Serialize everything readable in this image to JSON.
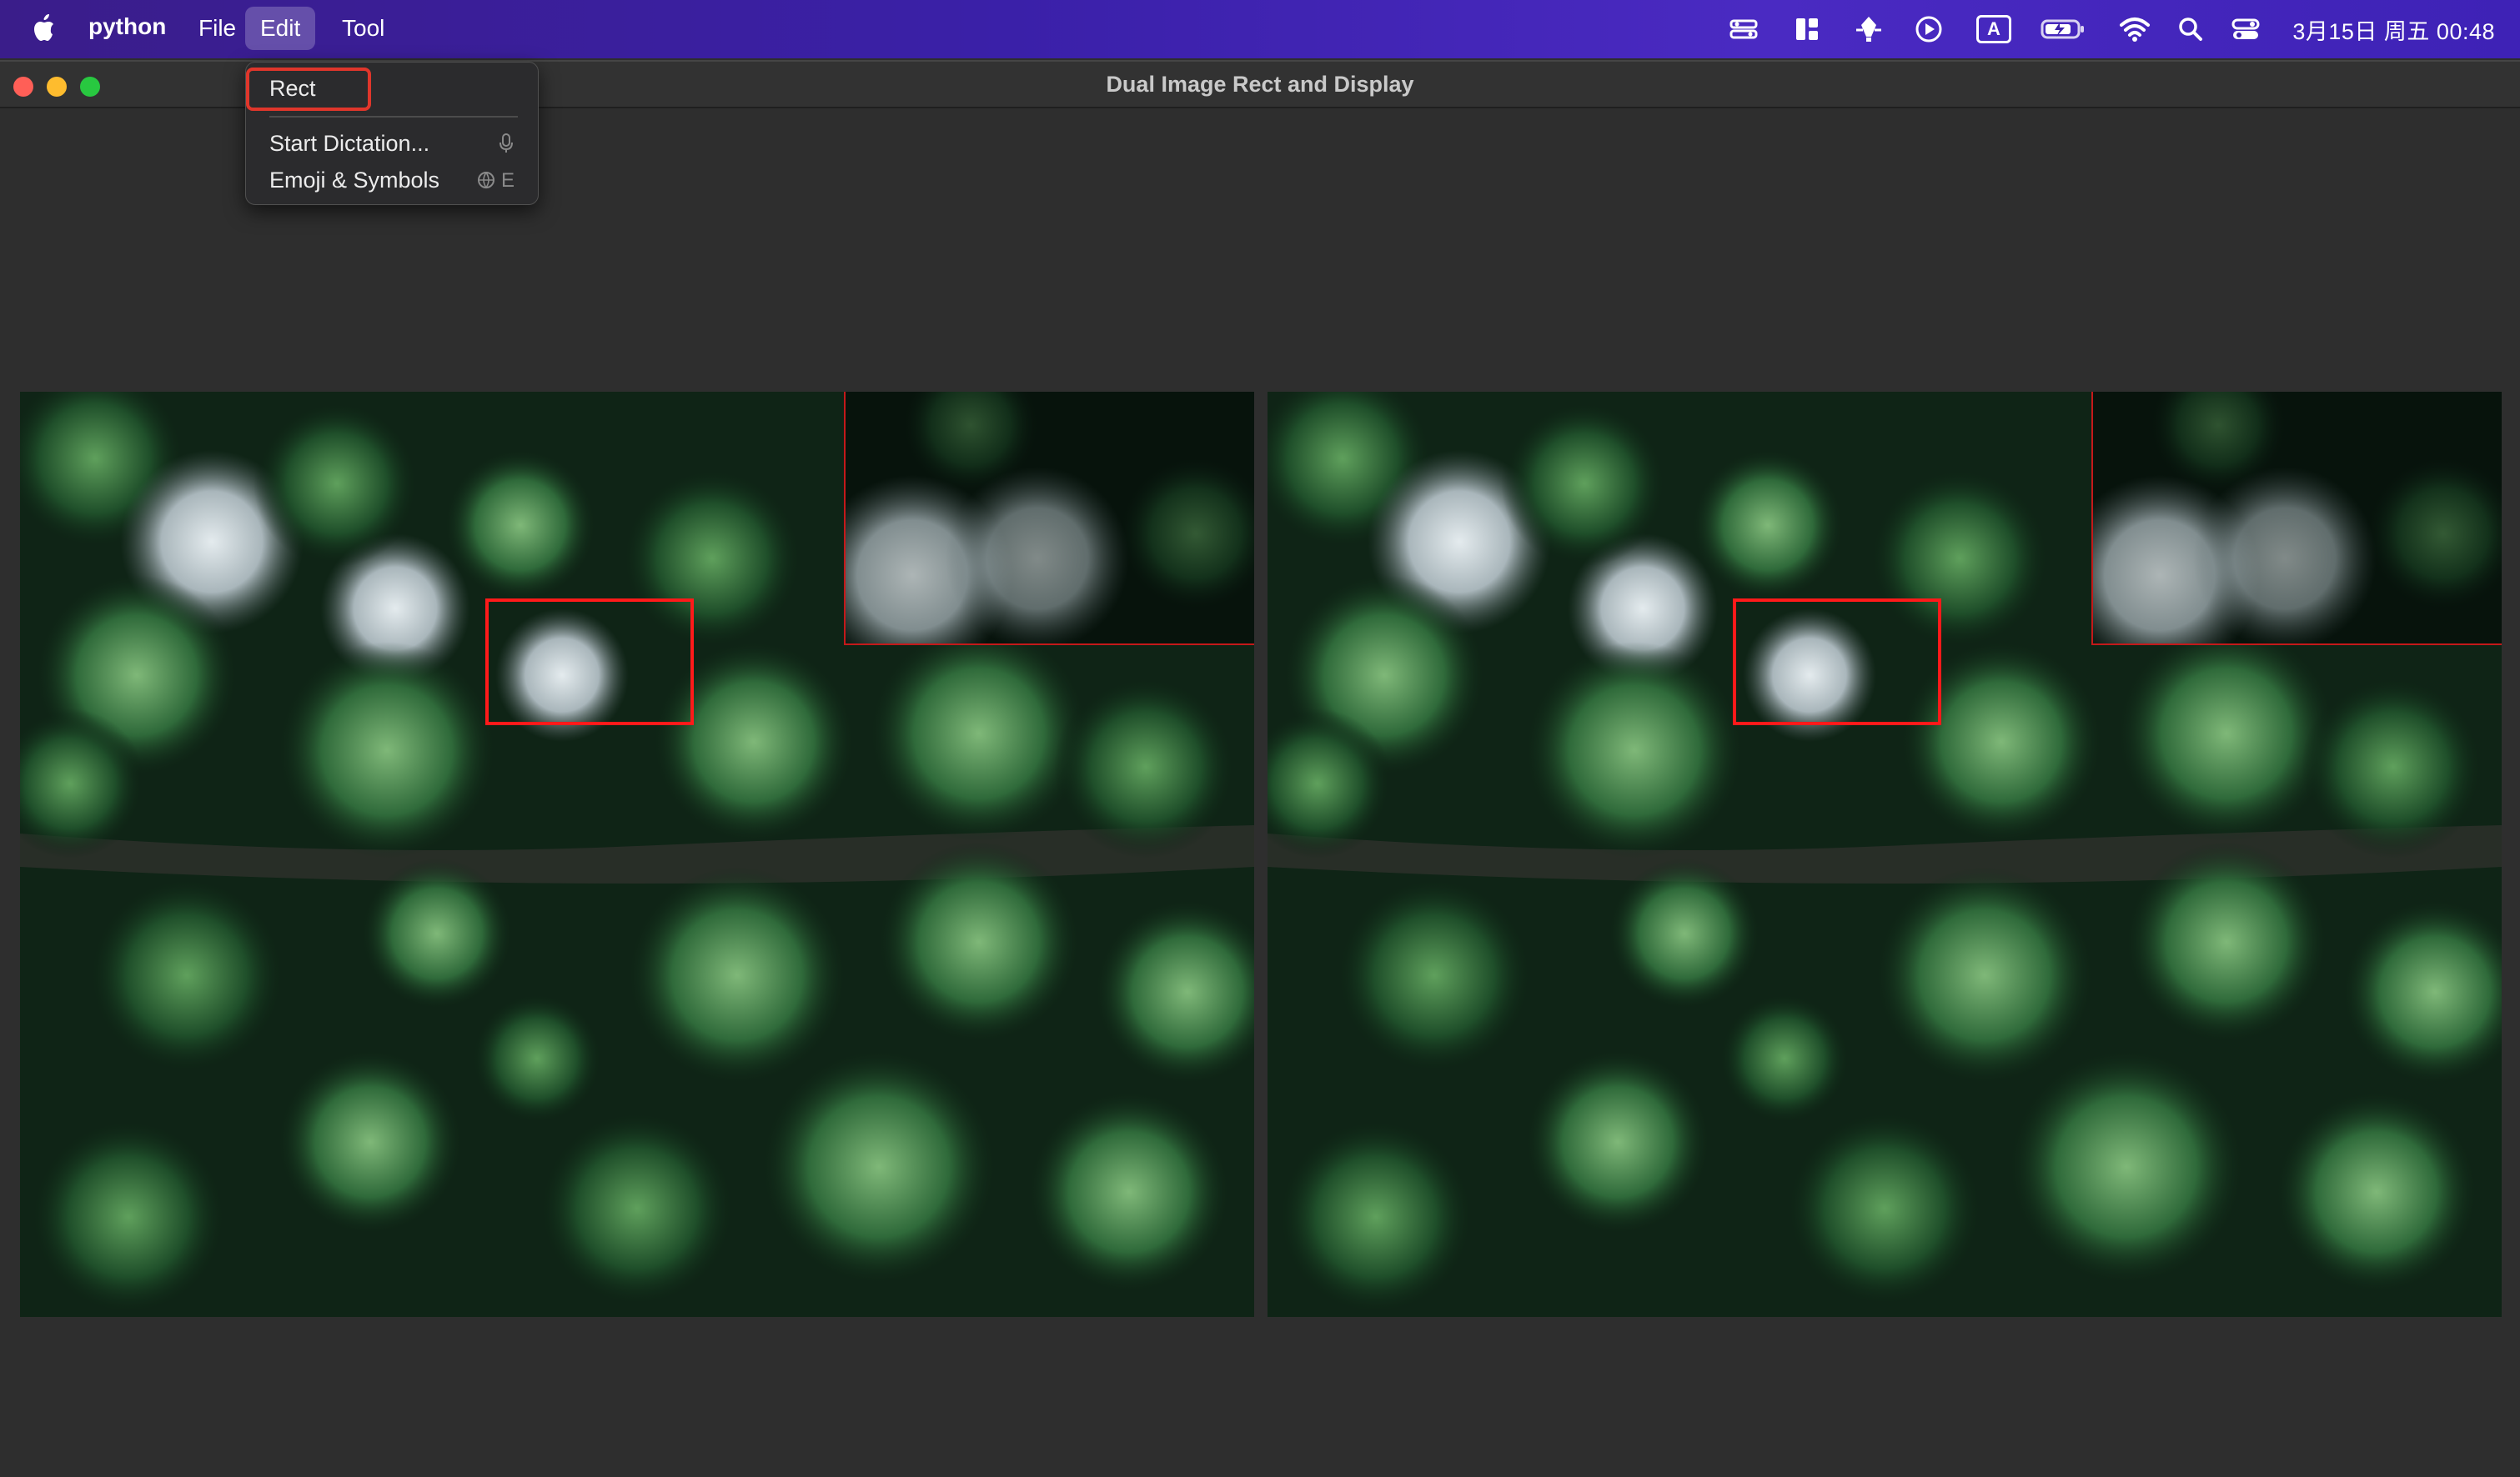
{
  "menubar": {
    "app_name": "python",
    "menus": [
      "File",
      "Edit",
      "Tool"
    ],
    "clock": "3月15日 周五 00:48",
    "status_icons": [
      "stage-manager-icon",
      "layout-icon",
      "pen-icon",
      "play-icon",
      "input-method-icon",
      "battery-icon",
      "wifi-icon",
      "search-icon",
      "control-center-icon"
    ],
    "input_method_label": "A"
  },
  "window": {
    "title": "Dual Image Rect and Display"
  },
  "edit_menu": {
    "items": [
      {
        "label": "Rect",
        "shortcut": ""
      },
      {
        "label": "Start Dictation...",
        "shortcut": "mic"
      },
      {
        "label": "Emoji & Symbols",
        "shortcut": "E"
      }
    ]
  },
  "colors": {
    "menubar_start": "#3a1d8a",
    "menubar_end": "#4a2ac2",
    "window_bg": "#2e2e2e",
    "roi_box": "#ff1a1a",
    "rect_highlight": "#e0362b"
  },
  "panels": [
    {
      "name": "left-image",
      "content": "aerial forest photo with selection rectangle and zoomed inset"
    },
    {
      "name": "right-image",
      "content": "aerial forest photo with selection rectangle and zoomed inset"
    }
  ]
}
